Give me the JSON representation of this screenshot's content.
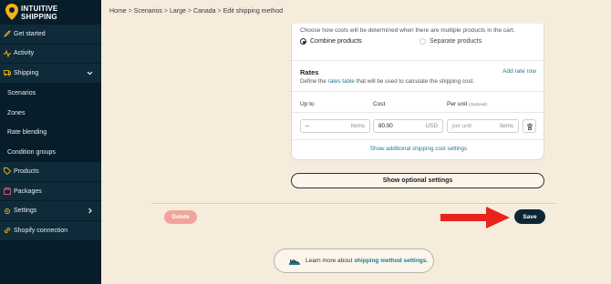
{
  "brand": {
    "line1": "INTUITIVE",
    "line2": "SHIPPING"
  },
  "sidebar": {
    "items": [
      {
        "label": "Get started",
        "icon": "rocket-icon"
      },
      {
        "label": "Activity",
        "icon": "activity-icon"
      },
      {
        "label": "Shipping",
        "icon": "shipping-icon",
        "expanded": true
      },
      {
        "label": "Scenarios"
      },
      {
        "label": "Zones"
      },
      {
        "label": "Rate blending"
      },
      {
        "label": "Condition groups"
      },
      {
        "label": "Products",
        "icon": "tag-icon"
      },
      {
        "label": "Packages",
        "icon": "package-icon"
      },
      {
        "label": "Settings",
        "icon": "gear-icon"
      },
      {
        "label": "Shopify connection",
        "icon": "link-icon"
      }
    ]
  },
  "breadcrumb": [
    "Home",
    "Scenarios",
    "Large",
    "Canada",
    "Edit shipping method"
  ],
  "cost_mode": {
    "hint": "Choose how costs will be determined when there are multiple products in the cart.",
    "option1": "Combine products",
    "option2": "Separate products",
    "selected": "Combine products"
  },
  "rates": {
    "title": "Rates",
    "add_link": "Add rate row",
    "desc_pre": "Define the ",
    "desc_link": "rates table",
    "desc_post": " that will be used to calculate the shipping cost.",
    "col_upto": "Up to",
    "col_cost": "Cost",
    "col_per_unit": "Per unit",
    "col_optional": "(Optional)",
    "row": {
      "upto_value": "--",
      "upto_unit": "items",
      "cost_value": "80.00",
      "cost_unit": "USD",
      "per_unit_placeholder": "per unit",
      "per_unit_unit": "items"
    },
    "show_additional": "Show additional shipping cost settings"
  },
  "buttons": {
    "optional": "Show optional settings",
    "delete": "Delete",
    "save": "Save"
  },
  "learn": {
    "text": "Learn more about",
    "link": "shipping method settings."
  },
  "colors": {
    "sidebar": "#071d2a",
    "accent": "#1e7a8c",
    "save": "#0c2634",
    "delete": "#f2a49c",
    "arrow": "#e8231c",
    "logo": "#f2b21b"
  }
}
